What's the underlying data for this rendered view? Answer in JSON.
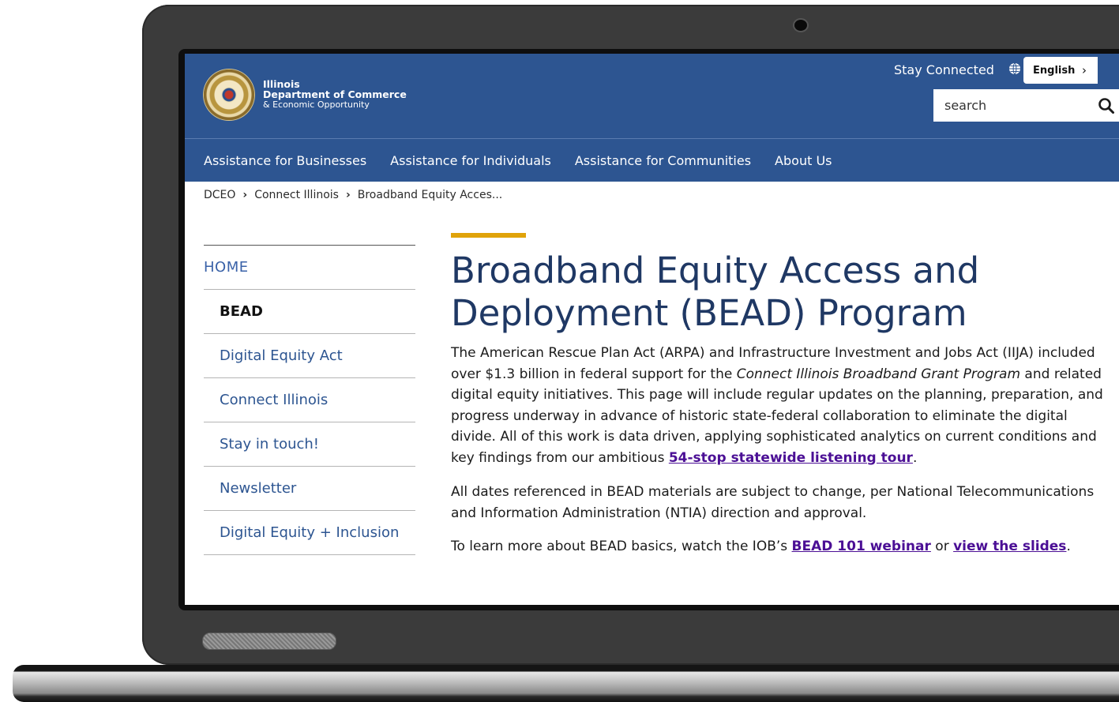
{
  "header": {
    "brand": {
      "line1": "Illinois",
      "line2": "Department of Commerce",
      "line3": "& Economic Opportunity"
    },
    "stay_connected": "Stay Connected",
    "language": "English",
    "search_placeholder": "search"
  },
  "nav": {
    "items": [
      {
        "label": "Assistance for Businesses"
      },
      {
        "label": "Assistance for Individuals"
      },
      {
        "label": "Assistance for Communities"
      },
      {
        "label": "About Us"
      }
    ]
  },
  "breadcrumb": {
    "items": [
      "DCEO",
      "Connect Illinois",
      "Broadband Equity Acces..."
    ]
  },
  "sidebar": {
    "home": "HOME",
    "items": [
      {
        "label": "BEAD",
        "active": true
      },
      {
        "label": "Digital Equity Act"
      },
      {
        "label": "Connect Illinois"
      },
      {
        "label": "Stay in touch!"
      },
      {
        "label": "Newsletter"
      },
      {
        "label": "Digital Equity + Inclusion"
      }
    ]
  },
  "main": {
    "title": "Broadband Equity Access and Deployment (BEAD) Program",
    "p1_a": "The American Rescue Plan Act (ARPA) and Infrastructure Investment and Jobs Act (IIJA) included over $1.3 billion in federal support for the ",
    "p1_em": "Connect Illinois Broadband Grant Program",
    "p1_b": " and related digital equity initiatives. This page will include regular updates on the planning, preparation, and progress underway in advance of historic state-federal collaboration to eliminate the digital divide. All of this work is data driven, applying sophisticated analytics on current conditions and key findings from our ambitious ",
    "p1_link": "54-stop statewide listening tour",
    "p1_end": ".",
    "p2": "All dates referenced in BEAD materials are subject to change, per National Telecommunications and Information Administration (NTIA) direction and approval.",
    "p3_a": "To learn more about BEAD basics, watch the IOB’s ",
    "p3_link1": "BEAD 101 webinar",
    "p3_mid": " or ",
    "p3_link2": "view the slides",
    "p3_end": "."
  }
}
